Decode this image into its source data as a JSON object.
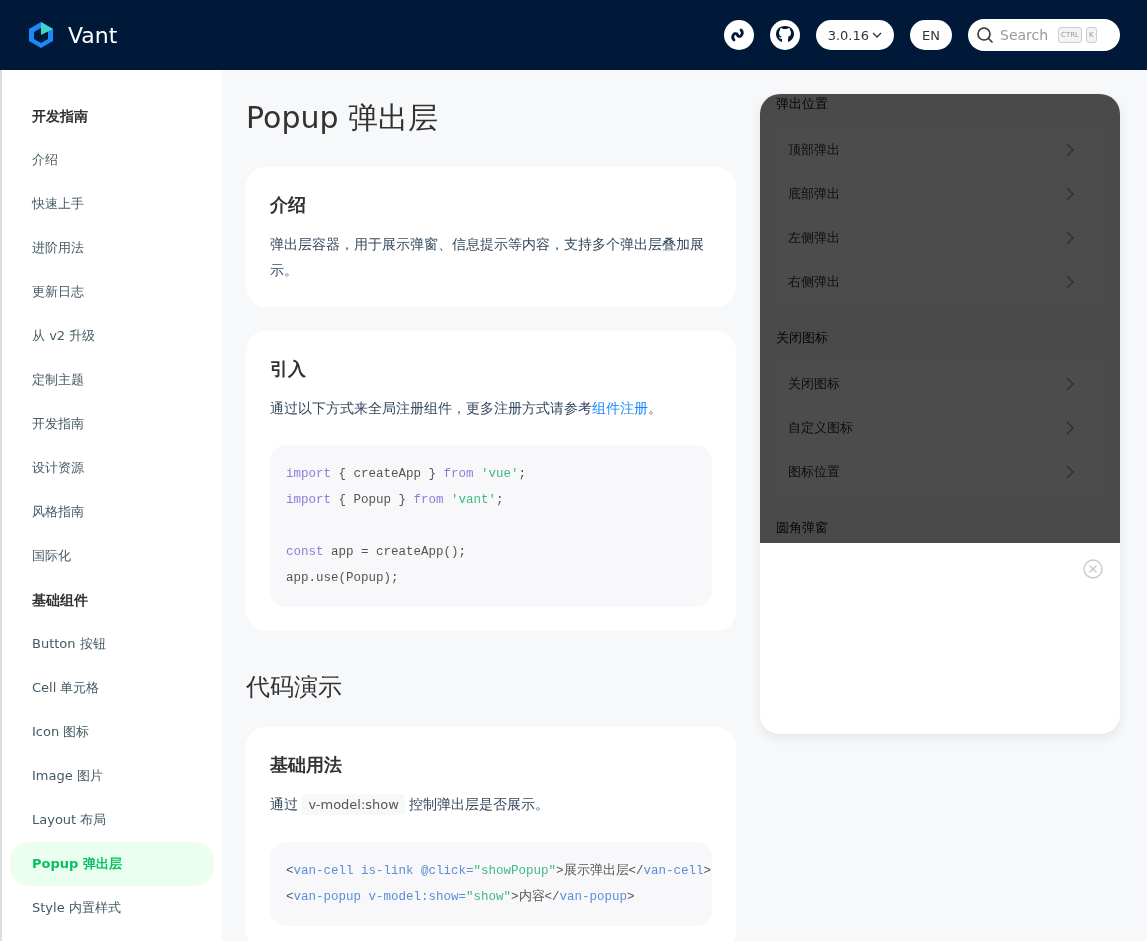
{
  "header": {
    "brand": "Vant",
    "version": "3.0.16",
    "language": "EN",
    "search": {
      "placeholder": "Search",
      "keys": [
        "CTRL",
        "K"
      ]
    }
  },
  "sidebar": {
    "groups": [
      {
        "title": "开发指南",
        "items": [
          {
            "label": "介绍",
            "selected": false
          },
          {
            "label": "快速上手",
            "selected": false
          },
          {
            "label": "进阶用法",
            "selected": false
          },
          {
            "label": "更新日志",
            "selected": false
          },
          {
            "label": "从 v2 升级",
            "selected": false
          },
          {
            "label": "定制主题",
            "selected": false
          },
          {
            "label": "开发指南",
            "selected": false
          },
          {
            "label": "设计资源",
            "selected": false
          },
          {
            "label": "风格指南",
            "selected": false
          },
          {
            "label": "国际化",
            "selected": false
          }
        ]
      },
      {
        "title": "基础组件",
        "items": [
          {
            "label": "Button 按钮",
            "selected": false
          },
          {
            "label": "Cell 单元格",
            "selected": false
          },
          {
            "label": "Icon 图标",
            "selected": false
          },
          {
            "label": "Image 图片",
            "selected": false
          },
          {
            "label": "Layout 布局",
            "selected": false
          },
          {
            "label": "Popup 弹出层",
            "selected": true
          },
          {
            "label": "Style 内置样式",
            "selected": false
          }
        ]
      }
    ]
  },
  "page_title": "Popup 弹出层",
  "sections": [
    {
      "kind": "card",
      "title": "介绍",
      "paragraph": [
        {
          "kind": "text",
          "text": "弹出层容器，用于展示弹窗、信息提示等内容，支持多个弹出层叠加展示。"
        }
      ]
    },
    {
      "kind": "card",
      "title": "引入",
      "paragraph": [
        {
          "kind": "text",
          "text": "通过以下方式来全局注册组件，更多注册方式请参考"
        },
        {
          "kind": "link",
          "text": "组件注册"
        },
        {
          "kind": "text",
          "text": "。"
        }
      ],
      "code": [
        {
          "tokens": [
            {
              "kind": "kw",
              "text": "import"
            },
            {
              "kind": "plain",
              "text": " { createApp } "
            },
            {
              "kind": "kw",
              "text": "from"
            },
            {
              "kind": "str",
              "text": " 'vue'"
            },
            {
              "kind": "plain",
              "text": ";"
            }
          ]
        },
        {
          "tokens": [
            {
              "kind": "kw",
              "text": "import"
            },
            {
              "kind": "plain",
              "text": " { Popup } "
            },
            {
              "kind": "kw",
              "text": "from"
            },
            {
              "kind": "str",
              "text": " 'vant'"
            },
            {
              "kind": "plain",
              "text": ";"
            }
          ]
        },
        {
          "spaced": true,
          "tokens": [
            {
              "kind": "kw",
              "text": "const"
            },
            {
              "kind": "plain",
              "text": " app = createApp();"
            }
          ]
        },
        {
          "tokens": [
            {
              "kind": "plain",
              "text": "app.use(Popup);"
            }
          ]
        }
      ]
    },
    {
      "kind": "heading",
      "title": "代码演示"
    },
    {
      "kind": "card",
      "title": "基础用法",
      "paragraph": [
        {
          "kind": "text",
          "text": "通过 "
        },
        {
          "kind": "code",
          "text": "v-model:show"
        },
        {
          "kind": "text",
          "text": " 控制弹出层是否展示。"
        }
      ],
      "code": [
        {
          "tokens": [
            {
              "kind": "plain",
              "text": "<"
            },
            {
              "kind": "tag",
              "text": "van-cell is-link @click="
            },
            {
              "kind": "str",
              "text": "\"showPopup\""
            },
            {
              "kind": "plain",
              "text": ">展示弹出层</"
            },
            {
              "kind": "tag",
              "text": "van-cell"
            },
            {
              "kind": "plain",
              "text": ">"
            }
          ]
        },
        {
          "tokens": [
            {
              "kind": "plain",
              "text": "<"
            },
            {
              "kind": "tag",
              "text": "van-popup v-model:show="
            },
            {
              "kind": "str",
              "text": "\"show\""
            },
            {
              "kind": "plain",
              "text": ">内容</"
            },
            {
              "kind": "tag",
              "text": "van-popup"
            },
            {
              "kind": "plain",
              "text": ">"
            }
          ]
        }
      ]
    }
  ],
  "simulator": {
    "groups": [
      {
        "title": "弹出位置",
        "items": [
          "顶部弹出",
          "底部弹出",
          "左侧弹出",
          "右侧弹出"
        ]
      },
      {
        "title": "关闭图标",
        "items": [
          "关闭图标",
          "自定义图标",
          "图标位置"
        ]
      },
      {
        "title": "圆角弹窗"
      }
    ],
    "popup": {
      "open": true,
      "closeable": true
    }
  }
}
